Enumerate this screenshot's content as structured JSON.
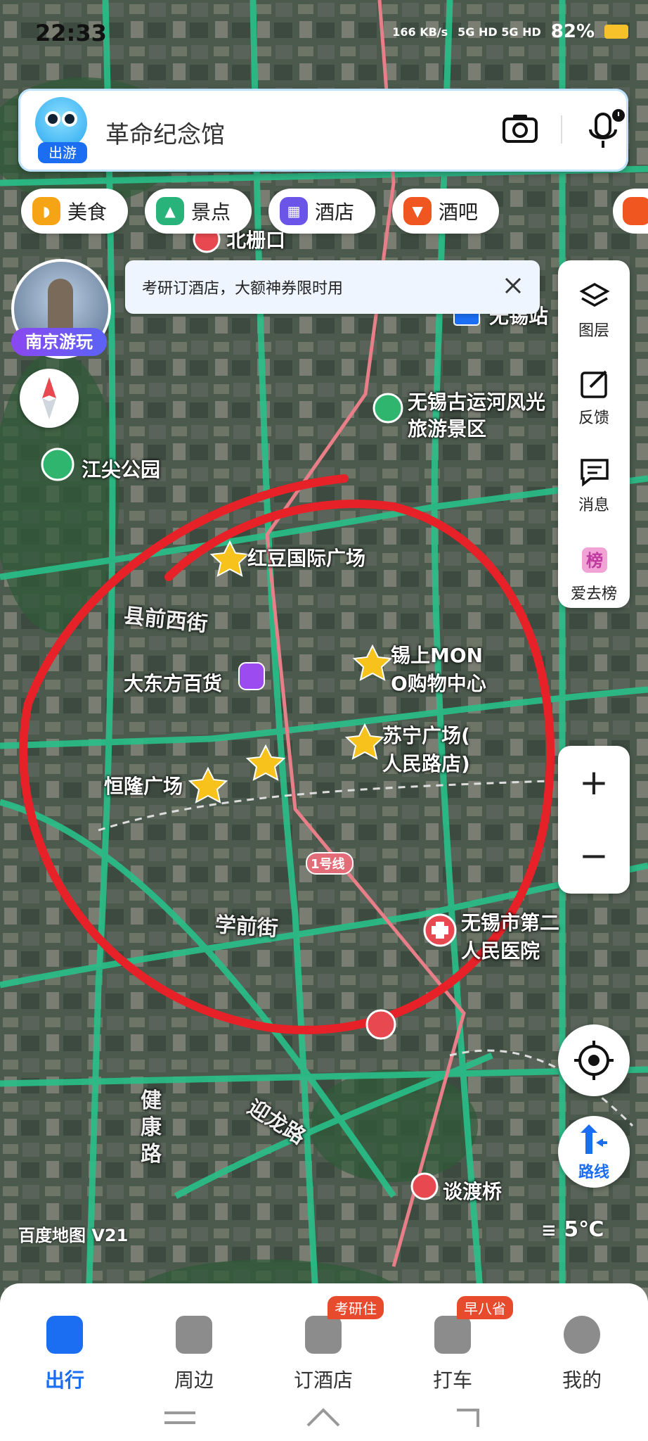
{
  "status_bar": {
    "time": "22:33",
    "net_speed": "166 KB/s",
    "signal": "5G HD 5G HD",
    "battery": "82%"
  },
  "search": {
    "placeholder": "革命纪念馆",
    "avatar_badge": "出游"
  },
  "categories": [
    {
      "label": "美食",
      "color": "#f5a416"
    },
    {
      "label": "景点",
      "color": "#27b37a"
    },
    {
      "label": "酒店",
      "color": "#6b55e8"
    },
    {
      "label": "酒吧",
      "color": "#f0561f"
    }
  ],
  "city_card": {
    "label": "南京游玩"
  },
  "notice": {
    "text": "考研订酒店，大额神券限时用"
  },
  "side_panel": {
    "layers": "图层",
    "feedback": "反馈",
    "messages": "消息",
    "ranking": "爱去榜"
  },
  "zoom": {
    "in": "+",
    "out": "−"
  },
  "route_label": "路线",
  "map_labels": {
    "beishankou": "北栅口",
    "wuxi_station": "无锡站",
    "canal_1": "无锡古运河风光",
    "canal_2": "旅游景区",
    "jiangjian_park": "江尖公园",
    "hongdou": "红豆国际广场",
    "xianqian_west": "县前西街",
    "mono_1": "锡上MON",
    "mono_2": "O购物中心",
    "dadongfang": "大东方百货",
    "suning_1": "苏宁广场(",
    "suning_2": "人民路店)",
    "henglong": "恒隆广场",
    "metro_line": "1号线",
    "xueqian": "学前街",
    "hospital_1": "无锡市第二",
    "hospital_2": "人民医院",
    "jiankang": "健康路",
    "yinglong": "迎龙路",
    "tandu": "谈渡桥"
  },
  "brand": "百度地图 V21",
  "weather": "5℃",
  "bottom_nav": [
    {
      "label": "出行",
      "active": true,
      "badge": ""
    },
    {
      "label": "周边",
      "active": false,
      "badge": ""
    },
    {
      "label": "订酒店",
      "active": false,
      "badge": "考研住"
    },
    {
      "label": "打车",
      "active": false,
      "badge": "早八省"
    },
    {
      "label": "我的",
      "active": false,
      "badge": ""
    }
  ]
}
